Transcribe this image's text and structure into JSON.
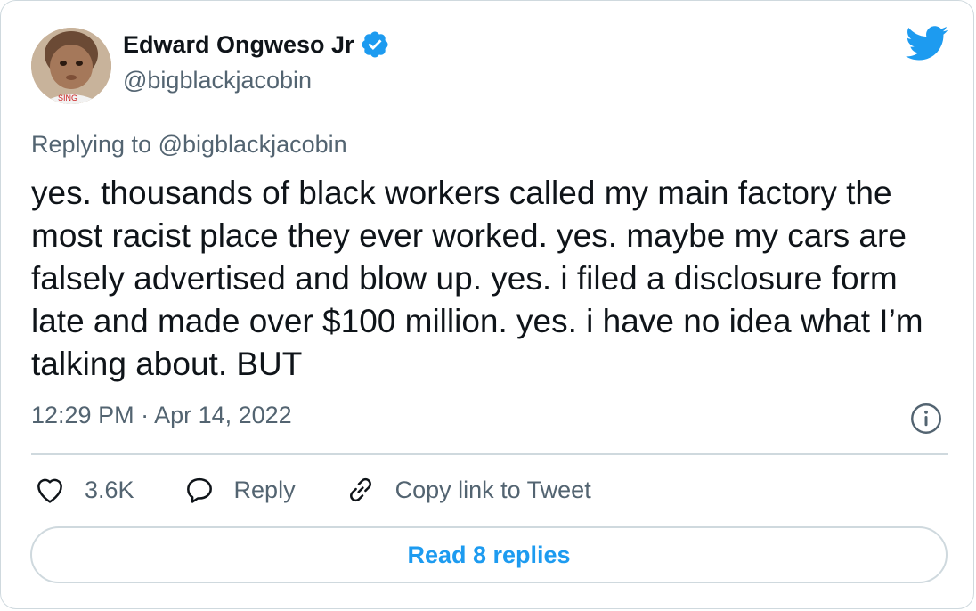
{
  "tweet": {
    "author": {
      "name": "Edward Ongweso Jr",
      "handle": "@bigblackjacobin",
      "verified": true
    },
    "replying_to_prefix": "Replying to ",
    "replying_to_handle": "@bigblackjacobin",
    "text": "yes. thousands of black workers called my main factory the most racist place they ever worked. yes. maybe my cars are falsely advertised and blow up. yes. i filed a disclosure form late and made over $100 million. yes. i have no idea what I’m talking about. BUT",
    "timestamp": "12:29 PM · Apr 14, 2022"
  },
  "actions": {
    "like_count": "3.6K",
    "reply_label": "Reply",
    "copy_link_label": "Copy link to Tweet"
  },
  "read_replies_label": "Read 8 replies",
  "icons": {
    "brand": "twitter-bird-icon",
    "verified": "verified-badge-icon",
    "info": "info-icon",
    "like": "heart-icon",
    "reply": "reply-bubble-icon",
    "link": "link-icon"
  },
  "colors": {
    "brand_blue": "#1d9bf0",
    "text": "#0f1419",
    "muted": "#536471",
    "border": "#cfd9de"
  }
}
